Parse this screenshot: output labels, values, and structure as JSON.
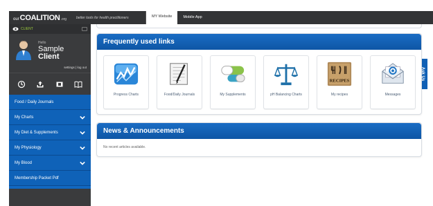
{
  "topbar": {
    "logo_our": "our",
    "logo_brand": "COALITION",
    "logo_org": ".org",
    "tagline": "better tools for health practitioners",
    "tabs": [
      {
        "label": "MY Website",
        "active": true
      },
      {
        "label": "Mobile App",
        "active": false
      }
    ]
  },
  "sidebar": {
    "client_label": "CLIENT",
    "hello": "Hello",
    "first_name": "Sample",
    "last_name": "Client",
    "profile_links": "settings | log out",
    "icons": [
      "clock-icon",
      "upload-icon",
      "film-icon",
      "book-icon"
    ],
    "menu": [
      {
        "label": "Food / Daily Journals",
        "has_chevron": false
      },
      {
        "label": "My Charts",
        "has_chevron": true
      },
      {
        "label": "My Diet & Supplements",
        "has_chevron": true
      },
      {
        "label": "My Physiology",
        "has_chevron": true
      },
      {
        "label": "My Blood",
        "has_chevron": true
      },
      {
        "label": "Membership Packet Pdf",
        "has_chevron": false
      }
    ]
  },
  "ask_us": "Ask Us",
  "frequent_links": {
    "title": "Frequently used links",
    "items": [
      {
        "label": "Progress Charts",
        "icon": "chart-icon"
      },
      {
        "label": "Food/Daily Journals",
        "icon": "journal-icon"
      },
      {
        "label": "My Supplements",
        "icon": "pill-icon"
      },
      {
        "label": "pH Balancing Charts",
        "icon": "scale-icon"
      },
      {
        "label": "My recipes",
        "icon": "recipe-icon"
      },
      {
        "label": "Messages",
        "icon": "email-icon"
      }
    ]
  },
  "news": {
    "title": "News & Announcements",
    "empty_text": "No recent articles available."
  },
  "colors": {
    "topbar": "#333436",
    "sidebar": "#3a3b3d",
    "menu_blue": "#0f62b8",
    "panel_header": "#1a6cc4",
    "client_green": "#9ccc3c"
  }
}
